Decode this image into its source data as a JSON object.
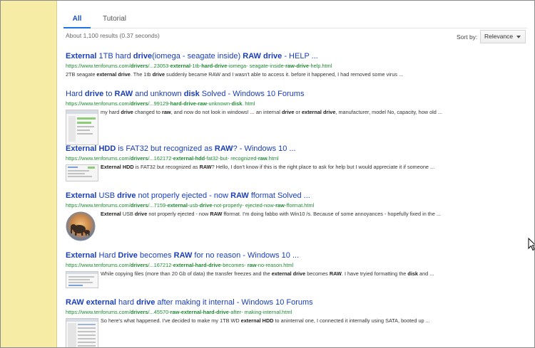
{
  "tabs": [
    {
      "label": "All",
      "active": true
    },
    {
      "label": "Tutorial",
      "active": false
    }
  ],
  "stats": "About 1,100 results (0.37 seconds)",
  "sort": {
    "label": "Sort by:",
    "value": "Relevance"
  },
  "results": [
    {
      "title": [
        [
          "b",
          "External"
        ],
        [
          "t",
          " 1TB hard "
        ],
        [
          "b",
          "drive"
        ],
        [
          "t",
          "(iomega - seagate inside) "
        ],
        [
          "b",
          "RAW drive"
        ],
        [
          "t",
          " - HELP ..."
        ]
      ],
      "url": [
        [
          "t",
          "https://www.tenforums.com/"
        ],
        [
          "b",
          "drivers"
        ],
        [
          "t",
          "/...23053-"
        ],
        [
          "b",
          "external"
        ],
        [
          "t",
          "-1tb-"
        ],
        [
          "b",
          "hard-drive"
        ],
        [
          "t",
          "-iomega- seagate-inside-"
        ],
        [
          "b",
          "raw-drive"
        ],
        [
          "t",
          "-help.html"
        ]
      ],
      "snippet": [
        [
          "t",
          "2TB seagate "
        ],
        [
          "b",
          "external drive"
        ],
        [
          "t",
          ". The 1tb "
        ],
        [
          "b",
          "drive"
        ],
        [
          "t",
          " suddenly became RAW and I wasn't able to access it. before it happened, I had removed some virus ..."
        ]
      ],
      "thumb": "none"
    },
    {
      "title": [
        [
          "t",
          "Hard "
        ],
        [
          "b",
          "drive"
        ],
        [
          "t",
          " to "
        ],
        [
          "b",
          "RAW"
        ],
        [
          "t",
          " and unknown "
        ],
        [
          "b",
          "disk"
        ],
        [
          "t",
          " Solved - Windows 10 Forums"
        ]
      ],
      "url": [
        [
          "t",
          "https://www.tenforums.com/"
        ],
        [
          "b",
          "drivers"
        ],
        [
          "t",
          "/...99129-"
        ],
        [
          "b",
          "hard-drive-raw"
        ],
        [
          "t",
          "-unknown-"
        ],
        [
          "b",
          "disk"
        ],
        [
          "t",
          ". html"
        ]
      ],
      "snippet": [
        [
          "t",
          "my hard "
        ],
        [
          "b",
          "drive"
        ],
        [
          "t",
          " changed to "
        ],
        [
          "b",
          "raw"
        ],
        [
          "t",
          ", and now do not look in windows! ... an internal "
        ],
        [
          "b",
          "drive"
        ],
        [
          "t",
          " or "
        ],
        [
          "b",
          "external drive"
        ],
        [
          "t",
          ", manufacturer, model No, capacity, how old ..."
        ]
      ],
      "thumb": "screen-green"
    },
    {
      "title": [
        [
          "b",
          "External HDD"
        ],
        [
          "t",
          " is FAT32 but recognized as "
        ],
        [
          "b",
          "RAW"
        ],
        [
          "t",
          "? - Windows 10 ..."
        ]
      ],
      "url": [
        [
          "t",
          "https://www.tenforums.com/"
        ],
        [
          "b",
          "drivers"
        ],
        [
          "t",
          "/...162172-"
        ],
        [
          "b",
          "external-hdd"
        ],
        [
          "t",
          "-fat32-but- recognized-"
        ],
        [
          "b",
          "raw"
        ],
        [
          "t",
          ".html"
        ]
      ],
      "snippet": [
        [
          "b",
          "External HDD"
        ],
        [
          "t",
          " is FAT32 but recognized as "
        ],
        [
          "b",
          "RAW"
        ],
        [
          "t",
          "? Hello, I don't know if this is the right place to ask for help but I would appreciate it if someone ..."
        ]
      ],
      "thumb": "screen-list"
    },
    {
      "title": [
        [
          "b",
          "External"
        ],
        [
          "t",
          " USB "
        ],
        [
          "b",
          "drive"
        ],
        [
          "t",
          " not properly ejected - now "
        ],
        [
          "b",
          "RAW"
        ],
        [
          "t",
          " fformat Solved ..."
        ]
      ],
      "url": [
        [
          "t",
          "https://www.tenforums.com/"
        ],
        [
          "b",
          "drivers"
        ],
        [
          "t",
          "/...7159-"
        ],
        [
          "b",
          "external"
        ],
        [
          "t",
          "-usb-"
        ],
        [
          "b",
          "drive"
        ],
        [
          "t",
          "-not-properly- ejected-now-"
        ],
        [
          "b",
          "raw"
        ],
        [
          "t",
          "-fformat.html"
        ]
      ],
      "snippet": [
        [
          "b",
          "External"
        ],
        [
          "t",
          " USB "
        ],
        [
          "b",
          "drive"
        ],
        [
          "t",
          " not properly ejected - now "
        ],
        [
          "b",
          "RAW"
        ],
        [
          "t",
          " fformat. I'm doing fabbo with Win10 /s. Because of some annoyances - hopefully fixed in the ..."
        ]
      ],
      "thumb": "elephant"
    },
    {
      "title": [
        [
          "b",
          "External"
        ],
        [
          "t",
          " Hard "
        ],
        [
          "b",
          "Drive"
        ],
        [
          "t",
          " becomes "
        ],
        [
          "b",
          "RAW"
        ],
        [
          "t",
          " for no reason - Windows 10 ..."
        ]
      ],
      "url": [
        [
          "t",
          "https://www.tenforums.com/"
        ],
        [
          "b",
          "drivers"
        ],
        [
          "t",
          "/...167212-"
        ],
        [
          "b",
          "external-hard-drive"
        ],
        [
          "t",
          "-becomes- "
        ],
        [
          "b",
          "raw"
        ],
        [
          "t",
          "-no-reason.html"
        ]
      ],
      "snippet": [
        [
          "t",
          "While copying files (more than 20 Gb of data) the transfer freezes and the "
        ],
        [
          "b",
          "external drive"
        ],
        [
          "t",
          " becomes "
        ],
        [
          "b",
          "RAW"
        ],
        [
          "t",
          ". I have tryied formatting the "
        ],
        [
          "b",
          "disk"
        ],
        [
          "t",
          " and ..."
        ]
      ],
      "thumb": "screen-lines"
    },
    {
      "title": [
        [
          "b",
          "RAW external"
        ],
        [
          "t",
          " hard "
        ],
        [
          "b",
          "drive"
        ],
        [
          "t",
          " after making it internal - Windows 10 Forums"
        ]
      ],
      "url": [
        [
          "t",
          "https://www.tenforums.com/"
        ],
        [
          "b",
          "drivers"
        ],
        [
          "t",
          "/...45570-"
        ],
        [
          "b",
          "raw-external-hard-drive"
        ],
        [
          "t",
          "-after- making-internal.html"
        ]
      ],
      "snippet": [
        [
          "t",
          "So here's what happened. I've decided to make my 1TB WD "
        ],
        [
          "b",
          "external HDD"
        ],
        [
          "t",
          " to aninternal one, I connected it internally using SATA, booted up ..."
        ]
      ],
      "thumb": "screen-grid"
    }
  ],
  "colors": {
    "sidebar": "#f6eca6",
    "link": "#1a3db8",
    "url": "#1b8a2e",
    "accent": "#1a73e8"
  }
}
